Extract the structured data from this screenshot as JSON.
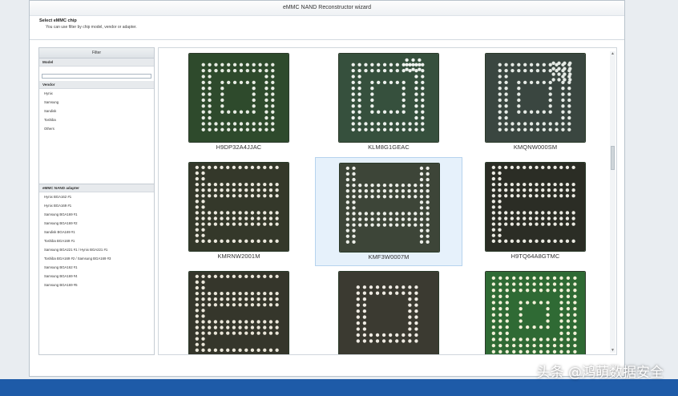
{
  "window": {
    "title": "eMMC NAND Reconstructor wizard"
  },
  "header": {
    "title": "Select eMMC chip",
    "subtitle": "You can use filter by chip model, vendor or adapter."
  },
  "filter": {
    "heading": "Filter",
    "model_label": "Model",
    "model_value": "",
    "vendor_label": "Vendor",
    "vendors": [
      "Hynix",
      "Samsung",
      "Sandisk",
      "Toshiba",
      "Others"
    ],
    "adapter_label": "eMMC NAND adapter",
    "adapters": [
      "Hynix BGA162 #1",
      "Hynix BGA169 #1",
      "Samsung BGA169 #1",
      "Samsung BGA169 #2",
      "Sandisk BGA169 #1",
      "Toshiba BGA169 #1",
      "Samsung BGA221 #1 / Hynix BGA221 #1",
      "Toshiba BGA169 #2 / Samsung BGA169 #3",
      "Samsung BGA162 #1",
      "Samsung BGA169 #4",
      "Samsung BGA169 #5"
    ]
  },
  "chips": [
    {
      "label": "H9DP32A4JJAC",
      "pcb": "#2e4a2c",
      "pad": "#e8ede4",
      "style": "a"
    },
    {
      "label": "KLM8G1GEAC",
      "pcb": "#36503d",
      "pad": "#eef2ee",
      "style": "b"
    },
    {
      "label": "KMQNW000SM",
      "pcb": "#3a4640",
      "pad": "#e6ebe6",
      "style": "c"
    },
    {
      "label": "KMRNW2001M",
      "pcb": "#34382a",
      "pad": "#ece9de",
      "style": "d"
    },
    {
      "label": "KMF3W0007M",
      "pcb": "#3d4538",
      "pad": "#eceee8",
      "style": "e"
    },
    {
      "label": "H9TQ64A8GTMC",
      "pcb": "#2b2d25",
      "pad": "#ecebe3",
      "style": "d"
    },
    {
      "label": "",
      "pcb": "#35362b",
      "pad": "#ebe7da",
      "style": "d"
    },
    {
      "label": "",
      "pcb": "#3b3a31",
      "pad": "#f0ece4",
      "style": "f"
    },
    {
      "label": "",
      "pcb": "#2f6a34",
      "pad": "#f3f1d8",
      "style": "g"
    }
  ],
  "selected_chip": "KMF3W0007M",
  "watermark": "头条 @鸿萌数据安全",
  "colors": {
    "accent": "#1e5ba8",
    "selection": "#e6f1fb"
  }
}
